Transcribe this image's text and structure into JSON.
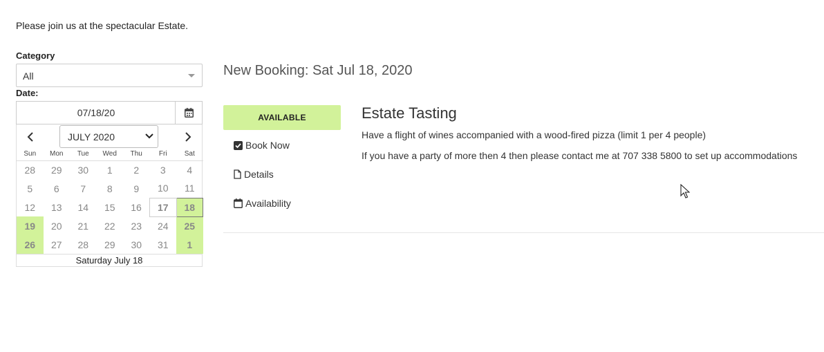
{
  "intro_text": "Please join us at the spectacular Estate.",
  "filters": {
    "category_label": "Category",
    "category_value": "All",
    "date_label": "Date:",
    "date_value": "07/18/20"
  },
  "calendar": {
    "month_label": "JULY 2020",
    "weekdays": [
      "Sun",
      "Mon",
      "Tue",
      "Wed",
      "Thu",
      "Fri",
      "Sat"
    ],
    "weeks": [
      [
        "28",
        "29",
        "30",
        "1",
        "2",
        "3",
        "4"
      ],
      [
        "5",
        "6",
        "7",
        "8",
        "9",
        "10",
        "11"
      ],
      [
        "12",
        "13",
        "14",
        "15",
        "16",
        "17",
        "18"
      ],
      [
        "19",
        "20",
        "21",
        "22",
        "23",
        "24",
        "25"
      ],
      [
        "26",
        "27",
        "28",
        "29",
        "30",
        "31",
        "1"
      ]
    ],
    "footer": "Saturday July 18",
    "available_color": "#d2f29a"
  },
  "booking": {
    "title": "New Booking: Sat Jul 18, 2020",
    "status": "AVAILABLE",
    "links": {
      "book_now": "Book Now",
      "details": "Details",
      "availability": "Availability"
    }
  },
  "event": {
    "title": "Estate Tasting",
    "description_1": "Have a flight of wines accompanied with a wood-fired pizza (limit 1 per 4 people)",
    "description_2": "If you have a party of more then 4 then please contact me at 707 338 5800 to set up accommodations"
  }
}
